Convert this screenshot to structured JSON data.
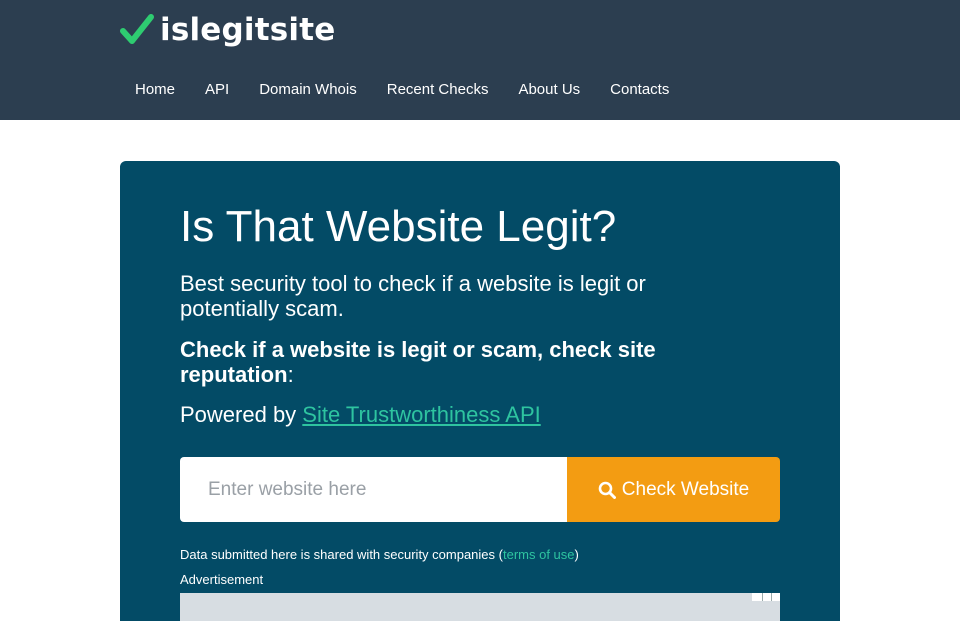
{
  "header": {
    "logo_text": "islegitsite",
    "nav": [
      "Home",
      "API",
      "Domain Whois",
      "Recent Checks",
      "About Us",
      "Contacts"
    ]
  },
  "hero": {
    "title": "Is That Website Legit?",
    "subtitle": "Best security tool to check if a website is legit or potentially scam.",
    "strong_text": "Check if a website is legit or scam, check site reputation",
    "strong_suffix": ":",
    "powered_prefix": "Powered by ",
    "powered_link": "Site Trustworthiness API",
    "search": {
      "placeholder": "Enter website here",
      "value": ""
    },
    "button_label": "Check Website",
    "disclaimer_prefix": "Data submitted here is shared with security companies (",
    "disclaimer_link": "terms of use",
    "disclaimer_suffix": ")",
    "ad_label": "Advertisement"
  },
  "colors": {
    "header_bg": "#2c3e50",
    "hero_bg": "#034b66",
    "accent": "#2ec4a0",
    "button": "#f39c12",
    "logo_check": "#2ecc71"
  },
  "icons": {
    "logo": "checkmark-icon",
    "button": "search-icon"
  }
}
